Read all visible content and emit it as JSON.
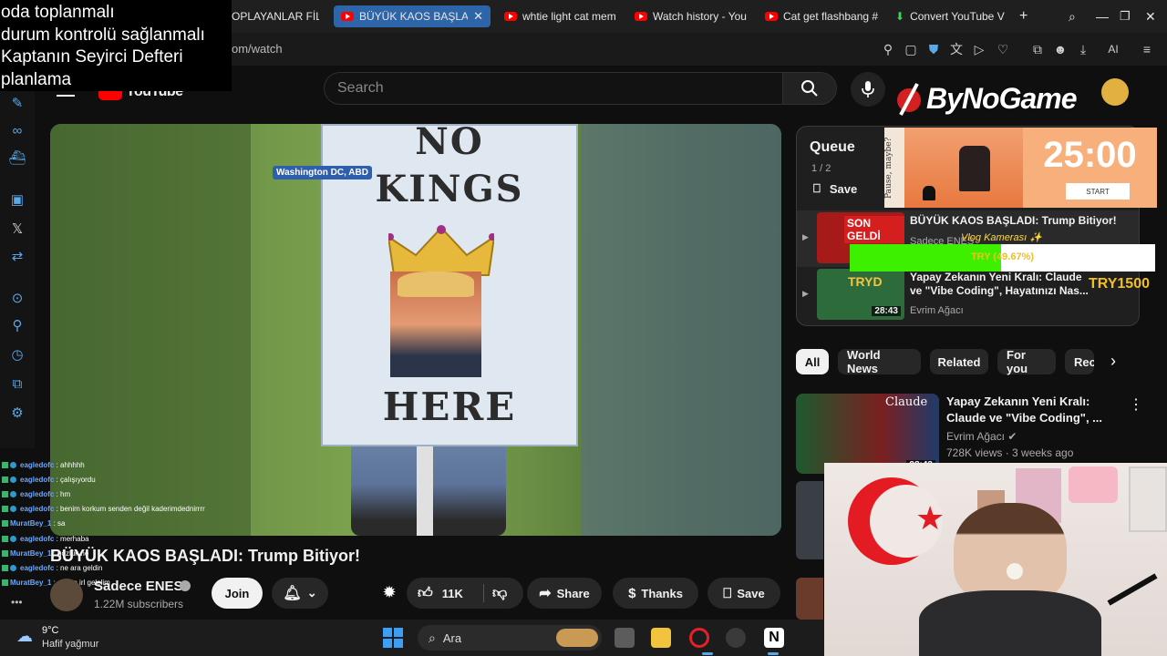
{
  "browser": {
    "tabs": [
      {
        "label": "OPLAYANLAR FİL"
      },
      {
        "label": "BÜYÜK KAOS BAŞLAD",
        "active": true
      },
      {
        "label": "whtie light cat mem"
      },
      {
        "label": "Watch history - You"
      },
      {
        "label": "Cat get flashbang #"
      },
      {
        "label": "Convert YouTube V"
      }
    ],
    "new_tab": "+",
    "url": "om/watch",
    "ai_label": "AI"
  },
  "notes": {
    "lines": [
      "oda toplanmalı",
      "durum kontrolü sağlanmalı",
      "Kaptanın Seyirci Defteri",
      "planlama"
    ]
  },
  "youtube": {
    "logo": "YouTube",
    "search_placeholder": "Search",
    "video": {
      "location_label": "Washington DC, ABD",
      "sign_top": "NO",
      "sign_kings": "KINGS",
      "sign_here": "HERE",
      "title": "BÜYÜK KAOS BAŞLADI: Trump Bitiyor!"
    },
    "channel": {
      "name": "Sadece ENES",
      "subscribers": "1.22M subscribers"
    },
    "actions": {
      "join": "Join",
      "likes": "11K",
      "share": "Share",
      "thanks": "Thanks",
      "save": "Save"
    }
  },
  "queue": {
    "title": "Queue",
    "count": "1 / 2",
    "save": "Save",
    "items": [
      {
        "title": "BÜYÜK KAOS BAŞLADI: Trump Bitiyor!",
        "channel": "Sadece ENES",
        "thumb_text": "SON GELDİ"
      },
      {
        "title": "Yapay Zekanın Yeni Kralı: Claude ve \"Vibe Coding\", Hayatınızı Nas...",
        "channel": "Evrim Ağacı",
        "duration": "28:43",
        "thumb_text": "TRYD"
      }
    ]
  },
  "overlay": {
    "brand": "ByNoGame",
    "timer": {
      "time": "25:00",
      "start": "START",
      "side_text": "Pause, maybe?"
    },
    "vlog_label": "Vlog Kamerası ✨",
    "progress_text": "TRY (49.67%)",
    "progress_value": 0.4967,
    "try_amount": "TRY1500"
  },
  "chips": [
    "All",
    "World News",
    "Related",
    "For you",
    "Rec"
  ],
  "recommendation": {
    "title_line1": "Yapay Zekanın Yeni Kralı:",
    "title_line2": "Claude ve \"Vibe Coding\", ...",
    "channel": "Evrim Ağacı",
    "meta": "728K views · 3 weeks ago",
    "duration": "28:43",
    "thumb_label": "Claude"
  },
  "chat": [
    {
      "nick": "eagledofc",
      "msg": ": ahhhhh"
    },
    {
      "nick": "eagledofc",
      "msg": ": çalışıyordu"
    },
    {
      "nick": "eagledofc",
      "msg": ": hm"
    },
    {
      "nick": "eagledofc",
      "msg": ": benim korkum senden değil kaderimdednirrrr"
    },
    {
      "nick": "MuratBey_1",
      "msg": ": sa"
    },
    {
      "nick": "eagledofc",
      "msg": ": merhaba"
    },
    {
      "nick": "MuratBey_1",
      "msg": ": gözlük ne"
    },
    {
      "nick": "eagledofc",
      "msg": ": ne ara geldin"
    },
    {
      "nick": "MuratBey_1",
      "msg": ": gebze irl gelelim"
    }
  ],
  "taskbar": {
    "temperature": "9°C",
    "weather": "Hafif yağmur",
    "search": "Ara"
  },
  "colors": {
    "accent": "#2e64a8",
    "youtube_red": "#ff0000",
    "progress_green": "#3cf000"
  }
}
